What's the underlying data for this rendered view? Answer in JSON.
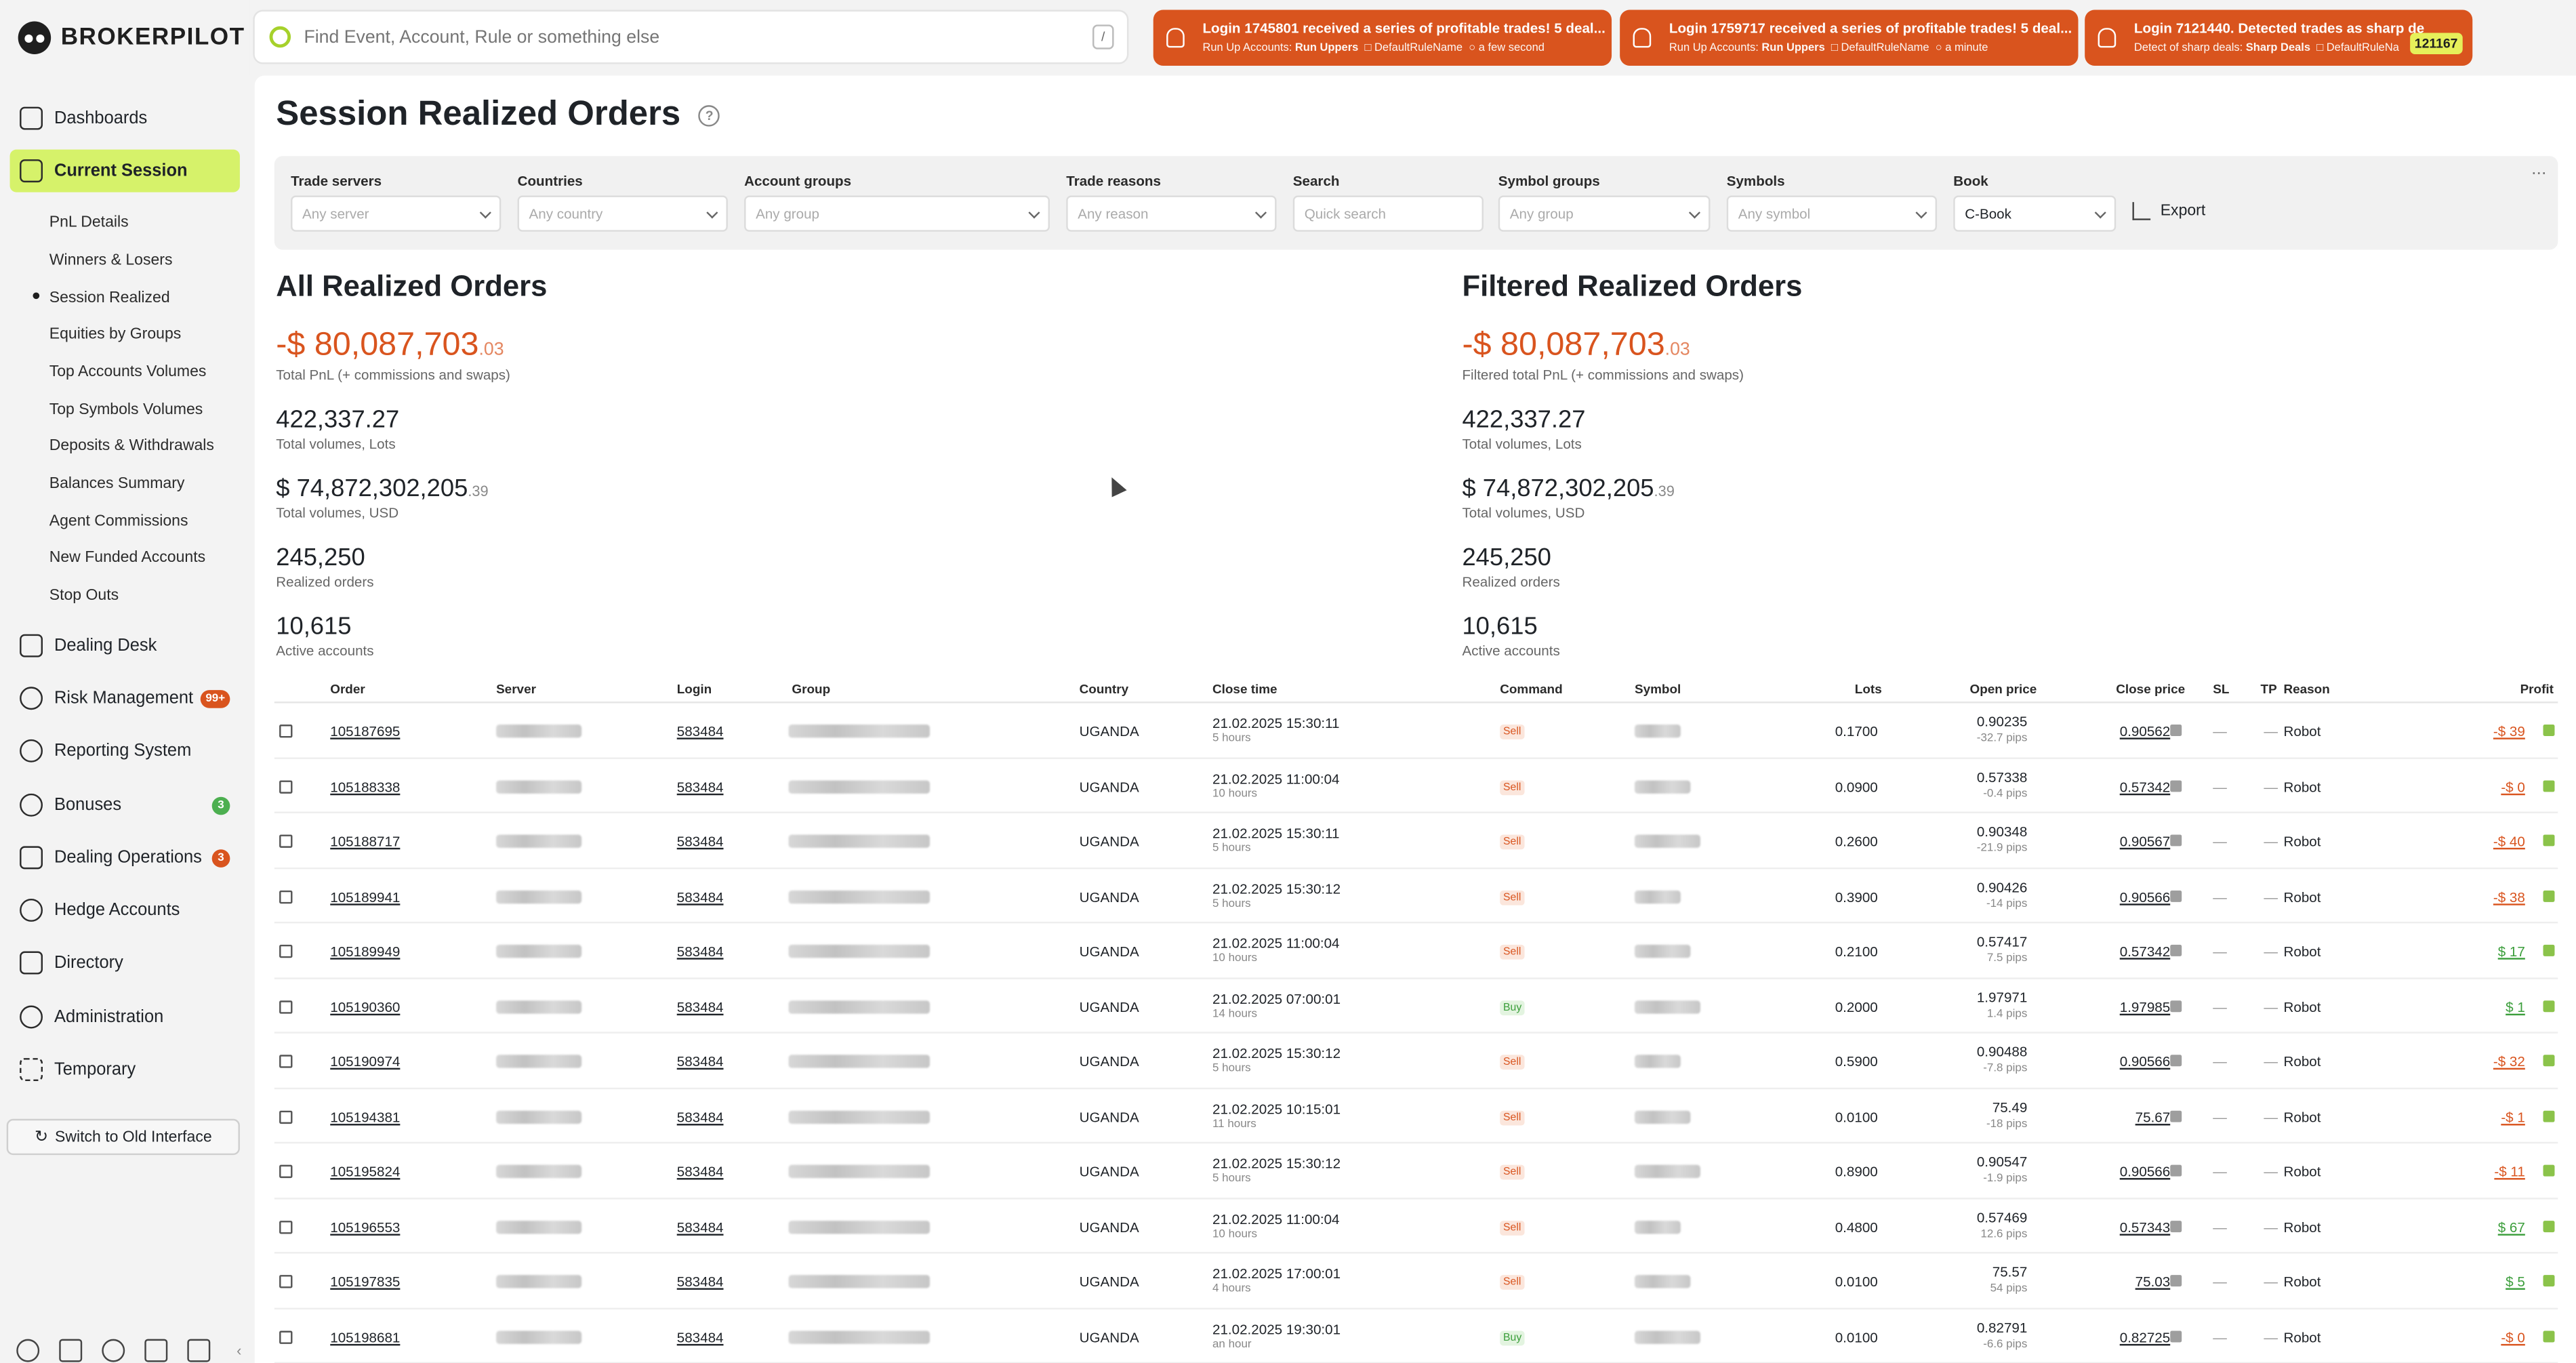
{
  "brand": "BROKERPILOT",
  "search_placeholder": "Find Event, Account, Rule or something else",
  "search_shortcut": "/",
  "notifications": [
    {
      "title": "Login 1745801 received a series of profitable trades! 5 deal...",
      "rule_type_label": "Run Up Accounts:",
      "rule_type": "Run Uppers",
      "rule_name": "DefaultRuleName",
      "time": "a few second"
    },
    {
      "title": "Login 1759717 received a series of profitable trades! 5 deal...",
      "rule_type_label": "Run Up Accounts:",
      "rule_type": "Run Uppers",
      "rule_name": "DefaultRuleName",
      "time": "a minute"
    },
    {
      "title": "Login 7121440. Detected trades as sharp de",
      "rule_type_label": "Detect of sharp deals:",
      "rule_type": "Sharp Deals",
      "rule_name": "DefaultRuleNa",
      "time": "",
      "count": "121167"
    }
  ],
  "nav": {
    "dashboards": "Dashboards",
    "current_session": "Current Session",
    "sub": [
      "PnL Details",
      "Winners & Losers",
      "Session Realized",
      "Equities by Groups",
      "Top Accounts Volumes",
      "Top Symbols Volumes",
      "Deposits & Withdrawals",
      "Balances Summary",
      "Agent Commissions",
      "New Funded Accounts",
      "Stop Outs"
    ],
    "dealing_desk": "Dealing Desk",
    "risk_management": "Risk Management",
    "risk_badge": "99+",
    "reporting_system": "Reporting System",
    "bonuses": "Bonuses",
    "bonuses_badge": "3",
    "dealing_operations": "Dealing Operations",
    "dealing_operations_badge": "3",
    "hedge_accounts": "Hedge Accounts",
    "directory": "Directory",
    "administration": "Administration",
    "temporary": "Temporary",
    "switch_old": "Switch to Old Interface"
  },
  "page_title": "Session Realized Orders",
  "help": "?",
  "filters": {
    "trade_servers": {
      "label": "Trade servers",
      "placeholder": "Any server"
    },
    "countries": {
      "label": "Countries",
      "placeholder": "Any country"
    },
    "account_groups": {
      "label": "Account groups",
      "placeholder": "Any group"
    },
    "trade_reasons": {
      "label": "Trade reasons",
      "placeholder": "Any reason"
    },
    "search": {
      "label": "Search",
      "placeholder": "Quick search"
    },
    "symbol_groups": {
      "label": "Symbol groups",
      "placeholder": "Any group"
    },
    "symbols": {
      "label": "Symbols",
      "placeholder": "Any symbol"
    },
    "book": {
      "label": "Book",
      "value": "C-Book"
    },
    "export": "Export",
    "more": "..."
  },
  "all": {
    "title": "All Realized Orders",
    "pnl_main": "-$ 80,087,703",
    "pnl_dec": ".03",
    "pnl_label": "Total PnL (+ commissions and swaps)",
    "lots": "422,337.27",
    "lots_label": "Total volumes, Lots",
    "usd_main": "$ 74,872,302,205",
    "usd_dec": ".39",
    "usd_label": "Total volumes, USD",
    "orders": "245,250",
    "orders_label": "Realized orders",
    "accounts": "10,615",
    "accounts_label": "Active accounts"
  },
  "filtered": {
    "title": "Filtered Realized Orders",
    "pnl_main": "-$ 80,087,703",
    "pnl_dec": ".03",
    "pnl_label": "Filtered total PnL (+ commissions and swaps)",
    "lots": "422,337.27",
    "lots_label": "Total volumes, Lots",
    "usd_main": "$ 74,872,302,205",
    "usd_dec": ".39",
    "usd_label": "Total volumes, USD",
    "orders": "245,250",
    "orders_label": "Realized orders",
    "accounts": "10,615",
    "accounts_label": "Active accounts"
  },
  "table": {
    "headers": {
      "order": "Order",
      "server": "Server",
      "login": "Login",
      "group": "Group",
      "country": "Country",
      "close_time": "Close time",
      "command": "Command",
      "symbol": "Symbol",
      "lots": "Lots",
      "open_price": "Open price",
      "close_price": "Close price",
      "sl": "SL",
      "tp": "TP",
      "reason": "Reason",
      "profit": "Profit"
    },
    "rows": [
      {
        "order": "105187695",
        "login": "583484",
        "country": "UGANDA",
        "close": "21.02.2025 15:30:11",
        "ago": "5 hours",
        "cmd": "Sell",
        "lots": "0.1700",
        "open": "0.90235",
        "pips": "-32.7 pips",
        "closep": "0.90562",
        "sl": "—",
        "tp": "—",
        "reason": "Robot",
        "profit": "-$ 39",
        "pos": false
      },
      {
        "order": "105188338",
        "login": "583484",
        "country": "UGANDA",
        "close": "21.02.2025 11:00:04",
        "ago": "10 hours",
        "cmd": "Sell",
        "lots": "0.0900",
        "open": "0.57338",
        "pips": "-0.4 pips",
        "closep": "0.57342",
        "sl": "—",
        "tp": "—",
        "reason": "Robot",
        "profit": "-$ 0",
        "pos": false
      },
      {
        "order": "105188717",
        "login": "583484",
        "country": "UGANDA",
        "close": "21.02.2025 15:30:11",
        "ago": "5 hours",
        "cmd": "Sell",
        "lots": "0.2600",
        "open": "0.90348",
        "pips": "-21.9 pips",
        "closep": "0.90567",
        "sl": "—",
        "tp": "—",
        "reason": "Robot",
        "profit": "-$ 40",
        "pos": false
      },
      {
        "order": "105189941",
        "login": "583484",
        "country": "UGANDA",
        "close": "21.02.2025 15:30:12",
        "ago": "5 hours",
        "cmd": "Sell",
        "lots": "0.3900",
        "open": "0.90426",
        "pips": "-14 pips",
        "closep": "0.90566",
        "sl": "—",
        "tp": "—",
        "reason": "Robot",
        "profit": "-$ 38",
        "pos": false
      },
      {
        "order": "105189949",
        "login": "583484",
        "country": "UGANDA",
        "close": "21.02.2025 11:00:04",
        "ago": "10 hours",
        "cmd": "Sell",
        "lots": "0.2100",
        "open": "0.57417",
        "pips": "7.5 pips",
        "closep": "0.57342",
        "sl": "—",
        "tp": "—",
        "reason": "Robot",
        "profit": "$ 17",
        "pos": true
      },
      {
        "order": "105190360",
        "login": "583484",
        "country": "UGANDA",
        "close": "21.02.2025 07:00:01",
        "ago": "14 hours",
        "cmd": "Buy",
        "lots": "0.2000",
        "open": "1.97971",
        "pips": "1.4 pips",
        "closep": "1.97985",
        "sl": "—",
        "tp": "—",
        "reason": "Robot",
        "profit": "$ 1",
        "pos": true
      },
      {
        "order": "105190974",
        "login": "583484",
        "country": "UGANDA",
        "close": "21.02.2025 15:30:12",
        "ago": "5 hours",
        "cmd": "Sell",
        "lots": "0.5900",
        "open": "0.90488",
        "pips": "-7.8 pips",
        "closep": "0.90566",
        "sl": "—",
        "tp": "—",
        "reason": "Robot",
        "profit": "-$ 32",
        "pos": false
      },
      {
        "order": "105194381",
        "login": "583484",
        "country": "UGANDA",
        "close": "21.02.2025 10:15:01",
        "ago": "11 hours",
        "cmd": "Sell",
        "lots": "0.0100",
        "open": "75.49",
        "pips": "-18 pips",
        "closep": "75.67",
        "sl": "—",
        "tp": "—",
        "reason": "Robot",
        "profit": "-$ 1",
        "pos": false
      },
      {
        "order": "105195824",
        "login": "583484",
        "country": "UGANDA",
        "close": "21.02.2025 15:30:12",
        "ago": "5 hours",
        "cmd": "Sell",
        "lots": "0.8900",
        "open": "0.90547",
        "pips": "-1.9 pips",
        "closep": "0.90566",
        "sl": "—",
        "tp": "—",
        "reason": "Robot",
        "profit": "-$ 11",
        "pos": false
      },
      {
        "order": "105196553",
        "login": "583484",
        "country": "UGANDA",
        "close": "21.02.2025 11:00:04",
        "ago": "10 hours",
        "cmd": "Sell",
        "lots": "0.4800",
        "open": "0.57469",
        "pips": "12.6 pips",
        "closep": "0.57343",
        "sl": "—",
        "tp": "—",
        "reason": "Robot",
        "profit": "$ 67",
        "pos": true
      },
      {
        "order": "105197835",
        "login": "583484",
        "country": "UGANDA",
        "close": "21.02.2025 17:00:01",
        "ago": "4 hours",
        "cmd": "Sell",
        "lots": "0.0100",
        "open": "75.57",
        "pips": "54 pips",
        "closep": "75.03",
        "sl": "—",
        "tp": "—",
        "reason": "Robot",
        "profit": "$ 5",
        "pos": true
      },
      {
        "order": "105198681",
        "login": "583484",
        "country": "UGANDA",
        "close": "21.02.2025 19:30:01",
        "ago": "an hour",
        "cmd": "Buy",
        "lots": "0.0100",
        "open": "0.82791",
        "pips": "-6.6 pips",
        "closep": "0.82725",
        "sl": "—",
        "tp": "—",
        "reason": "Robot",
        "profit": "-$ 0",
        "pos": false
      }
    ]
  }
}
